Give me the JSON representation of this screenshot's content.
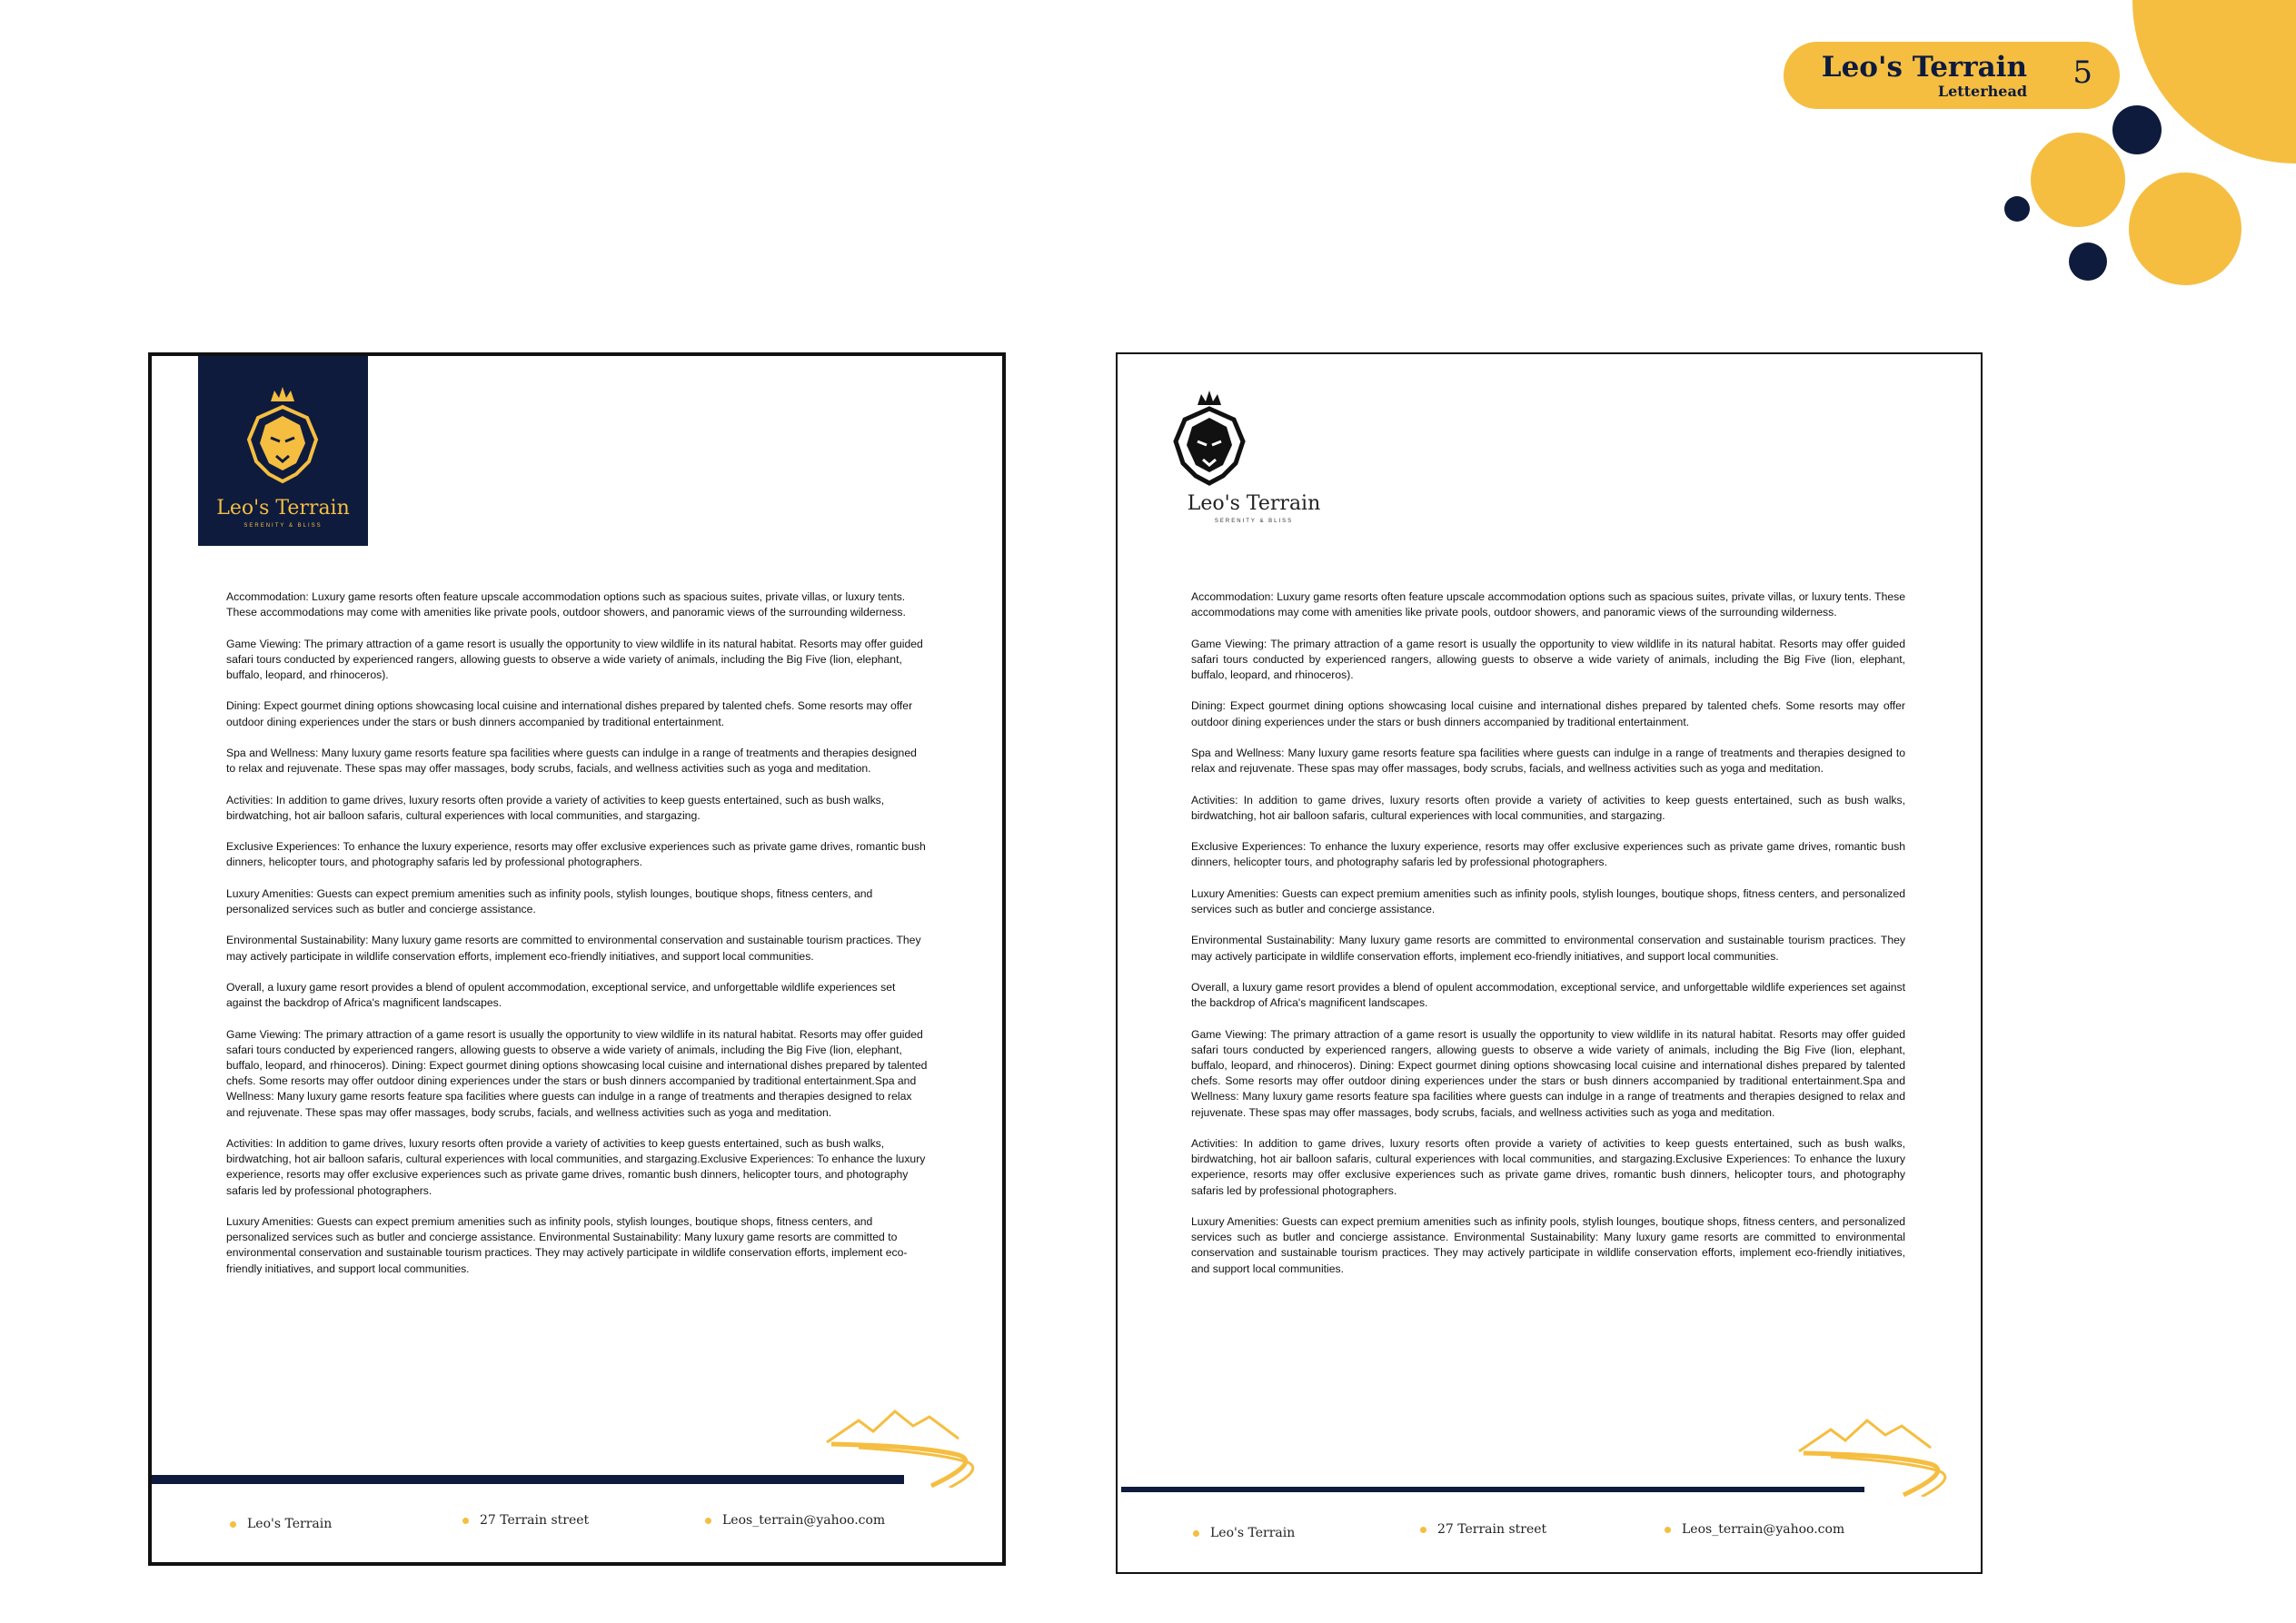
{
  "header": {
    "title": "Leo's Terrain",
    "subtitle": "Letterhead",
    "page_number": "5"
  },
  "colors": {
    "accent": "#f5be41",
    "navy": "#0e1b3d"
  },
  "letterheads": [
    {
      "brand": "Leo's Terrain",
      "tagline": "SERENITY & BLISS",
      "paragraphs": [
        "Accommodation: Luxury game resorts often feature upscale accommodation options such as spacious suites, private villas, or luxury tents. These accommodations may come with amenities like private pools, outdoor showers, and panoramic views of the surrounding wilderness.",
        "Game Viewing: The primary attraction of a game resort is usually the opportunity to view wildlife in its natural habitat. Resorts may offer guided safari tours conducted by experienced rangers, allowing guests to observe a wide variety of animals, including the Big Five (lion, elephant, buffalo, leopard, and rhinoceros).",
        "Dining: Expect gourmet dining options showcasing local cuisine and international dishes prepared by talented chefs. Some resorts may offer outdoor dining experiences under the stars or bush dinners accompanied by traditional entertainment.",
        "Spa and Wellness: Many luxury game resorts feature spa facilities where guests can indulge in a range of treatments and therapies designed to relax and rejuvenate. These spas may offer massages, body scrubs, facials, and wellness activities such as yoga and meditation.",
        "Activities: In addition to game drives, luxury resorts often provide a variety of activities to keep guests entertained, such as bush walks, birdwatching, hot air balloon safaris, cultural experiences with local communities, and stargazing.",
        "Exclusive Experiences: To enhance the luxury experience, resorts may offer exclusive experiences such as private game drives, romantic bush dinners, helicopter tours, and photography safaris led by professional photographers.",
        "Luxury Amenities: Guests can expect premium amenities such as infinity pools, stylish lounges, boutique shops, fitness centers, and personalized services such as butler and concierge assistance.",
        "Environmental Sustainability: Many luxury game resorts are committed to environmental conservation and sustainable tourism practices. They may actively participate in wildlife conservation efforts, implement eco-friendly initiatives, and support local communities.",
        "Overall, a luxury game resort provides a blend of opulent accommodation, exceptional service, and unforgettable wildlife experiences set against the backdrop of Africa's magnificent landscapes.",
        "Game Viewing: The primary attraction of a game resort is usually the opportunity to view wildlife in its natural habitat. Resorts may offer guided safari tours conducted by experienced rangers, allowing guests to observe a wide variety of animals, including the Big Five (lion, elephant, buffalo, leopard, and rhinoceros). Dining: Expect gourmet dining options showcasing local cuisine and international dishes prepared by talented chefs. Some resorts may offer outdoor dining experiences under the stars or bush dinners accompanied by traditional entertainment.Spa and Wellness: Many luxury game resorts feature spa facilities where guests can indulge in a range of treatments and therapies designed to relax and rejuvenate. These spas may offer massages, body scrubs, facials, and wellness activities such as yoga and meditation.",
        "Activities: In addition to game drives, luxury resorts often provide a variety of activities to keep guests entertained, such as bush walks, birdwatching, hot air balloon safaris, cultural experiences with local communities, and stargazing.Exclusive Experiences: To enhance the luxury experience, resorts may offer exclusive experiences such as private game drives, romantic bush dinners, helicopter tours, and photography safaris led by professional photographers.",
        "Luxury Amenities: Guests can expect premium amenities such as infinity pools, stylish lounges, boutique shops, fitness centers, and personalized services such as butler and concierge assistance. Environmental Sustainability: Many luxury game resorts are committed to environmental conservation and sustainable tourism practices. They may actively participate in wildlife conservation efforts, implement eco-friendly initiatives, and support local communities."
      ],
      "footer": [
        "Leo's Terrain",
        "27 Terrain street",
        "Leos_terrain@yahoo.com"
      ]
    },
    {
      "brand": "Leo's Terrain",
      "tagline": "SERENITY & BLISS",
      "paragraphs": [
        "Accommodation: Luxury game resorts often feature upscale accommodation options such as spacious suites, private villas, or luxury tents. These accommodations may come with amenities like private pools, outdoor showers, and panoramic views of the surrounding wilderness.",
        "Game Viewing: The primary attraction of a game resort is usually the opportunity to view wildlife in its natural habitat. Resorts may offer guided safari tours conducted by experienced rangers, allowing guests to observe a wide variety of animals, including the Big Five (lion, elephant, buffalo, leopard, and rhinoceros).",
        "Dining: Expect gourmet dining options showcasing local cuisine and international dishes prepared by talented chefs. Some resorts may offer outdoor dining experiences under the stars or bush dinners accompanied by traditional entertainment.",
        "Spa and Wellness: Many luxury game resorts feature spa facilities where guests can indulge in a range of treatments and therapies designed to relax and rejuvenate. These spas may offer massages, body scrubs, facials, and wellness activities such as yoga and meditation.",
        "Activities: In addition to game drives, luxury resorts often provide a variety of activities to keep guests entertained, such as bush walks, birdwatching, hot air balloon safaris, cultural experiences with local communities, and stargazing.",
        "Exclusive Experiences: To enhance the luxury experience, resorts may offer exclusive experiences such as private game drives, romantic bush dinners, helicopter tours, and photography safaris led by professional photographers.",
        "Luxury Amenities: Guests can expect premium amenities such as infinity pools, stylish lounges, boutique shops, fitness centers, and personalized services such as butler and concierge assistance.",
        "Environmental Sustainability: Many luxury game resorts are committed to environmental conservation and sustainable tourism practices. They may actively participate in wildlife conservation efforts, implement eco-friendly initiatives, and support local communities.",
        "Overall, a luxury game resort provides a blend of opulent accommodation, exceptional service, and unforgettable wildlife experiences set against the backdrop of Africa's magnificent landscapes.",
        "Game Viewing: The primary attraction of a game resort is usually the opportunity to view wildlife in its natural habitat. Resorts may offer guided safari tours conducted by experienced rangers, allowing guests to observe a wide variety of animals, including the Big Five (lion, elephant, buffalo, leopard, and rhinoceros). Dining: Expect gourmet dining options showcasing local cuisine and international dishes prepared by talented chefs. Some resorts may offer outdoor dining experiences under the stars or bush dinners accompanied by traditional entertainment.Spa and Wellness: Many luxury game resorts feature spa facilities where guests can indulge in a range of treatments and therapies designed to relax and rejuvenate. These spas may offer massages, body scrubs, facials, and wellness activities such as yoga and meditation.",
        "Activities: In addition to game drives, luxury resorts often provide a variety of activities to keep guests entertained, such as bush walks, birdwatching, hot air balloon safaris, cultural experiences with local communities, and stargazing.Exclusive Experiences: To enhance the luxury experience, resorts may offer exclusive experiences such as private game drives, romantic bush dinners, helicopter tours, and photography safaris led by professional photographers.",
        "Luxury Amenities: Guests can expect premium amenities such as infinity pools, stylish lounges, boutique shops, fitness centers, and personalized services such as butler and concierge assistance. Environmental Sustainability: Many luxury game resorts are committed to environmental conservation and sustainable tourism practices. They may actively participate in wildlife conservation efforts, implement eco-friendly initiatives, and support local communities."
      ],
      "footer": [
        "Leo's Terrain",
        "27 Terrain street",
        "Leos_terrain@yahoo.com"
      ]
    }
  ]
}
